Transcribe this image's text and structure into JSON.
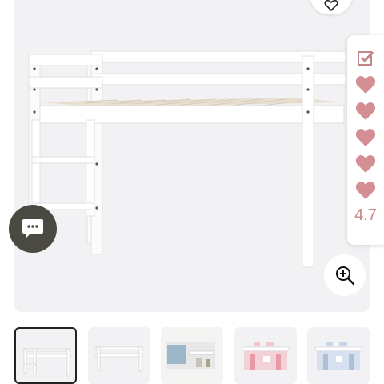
{
  "product_gallery": {
    "main_image_alt": "",
    "rating": {
      "value": "4.7",
      "hearts_filled": 5,
      "hearts_total": 5,
      "heart_color": "#d48f95",
      "text_color": "#c48686"
    },
    "thumbnails": [
      {
        "name": "white-loft-bed-front",
        "selected": true
      },
      {
        "name": "white-loft-bed-side",
        "selected": false
      },
      {
        "name": "loft-bed-room-scene",
        "selected": false
      },
      {
        "name": "loft-bed-pink-curtain",
        "selected": false
      },
      {
        "name": "loft-bed-blue-curtain",
        "selected": false
      }
    ],
    "icons": {
      "wishlist": "heart-icon",
      "zoom": "zoom-in-icon",
      "chat": "chat-bubble-icon",
      "compare": "checkbox-icon"
    }
  }
}
